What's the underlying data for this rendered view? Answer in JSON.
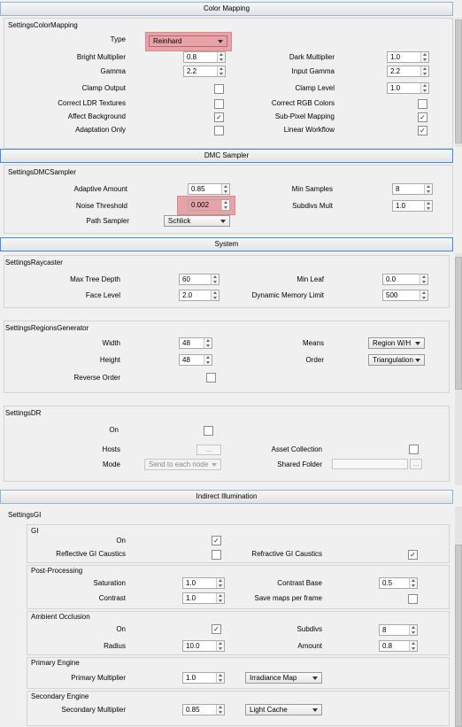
{
  "color_mapping": {
    "header": "Color Mapping",
    "group": "SettingsColorMapping",
    "type_label": "Type",
    "type_value": "Reinhard",
    "bright_label": "Bright Multiplier",
    "bright_value": "0.8",
    "dark_label": "Dark Multiplier",
    "dark_value": "1.0",
    "gamma_label": "Gamma",
    "gamma_value": "2.2",
    "input_gamma_label": "Input Gamma",
    "input_gamma_value": "2.2",
    "clamp_output_label": "Clamp Output",
    "clamp_output_checked": false,
    "clamp_level_label": "Clamp Level",
    "clamp_level_value": "1.0",
    "correct_ldr_label": "Correct LDR Textures",
    "correct_ldr_checked": false,
    "correct_rgb_label": "Correct RGB Colors",
    "correct_rgb_checked": false,
    "affect_bg_label": "Affect Background",
    "affect_bg_checked": true,
    "subpixel_label": "Sub-Pixel Mapping",
    "subpixel_checked": true,
    "adaptation_label": "Adaptation Only",
    "adaptation_checked": false,
    "linear_label": "Linear Workflow",
    "linear_checked": true
  },
  "dmc": {
    "header": "DMC Sampler",
    "group": "SettingsDMCSampler",
    "adaptive_label": "Adaptive Amount",
    "adaptive_value": "0.85",
    "min_samples_label": "Min Samples",
    "min_samples_value": "8",
    "noise_label": "Noise Threshold",
    "noise_value": "0.002",
    "subdivs_mult_label": "Subdivs Mult",
    "subdivs_mult_value": "1.0",
    "path_label": "Path Sampler",
    "path_value": "Schlick"
  },
  "system": {
    "header": "System",
    "raycaster_group": "SettingsRaycaster",
    "max_tree_label": "Max Tree Depth",
    "max_tree_value": "60",
    "min_leaf_label": "Min Leaf",
    "min_leaf_value": "0.0",
    "face_level_label": "Face Level",
    "face_level_value": "2.0",
    "dyn_mem_label": "Dynamic Memory Limit",
    "dyn_mem_value": "500",
    "regions_group": "SettingsRegionsGenerator",
    "width_label": "Width",
    "width_value": "48",
    "means_label": "Means",
    "means_value": "Region W/H",
    "height_label": "Height",
    "height_value": "48",
    "order_label": "Order",
    "order_value": "Triangulation",
    "reverse_label": "Reverse Order",
    "reverse_checked": false,
    "dr_group": "SettingsDR",
    "on_label": "On",
    "on_checked": false,
    "hosts_label": "Hosts",
    "hosts_button": "...",
    "asset_label": "Asset Collection",
    "asset_checked": false,
    "mode_label": "Mode",
    "mode_value": "Send to each node",
    "shared_label": "Shared Folder",
    "shared_value": "",
    "shared_button": "..."
  },
  "gi": {
    "header": "Indirect Illumination",
    "group": "SettingsGI",
    "gi_sub": "GI",
    "on_label": "On",
    "on_checked": true,
    "reflective_label": "Reflective GI Caustics",
    "reflective_checked": false,
    "refractive_label": "Refractive GI Caustics",
    "refractive_checked": true,
    "post_sub": "Post-Processing",
    "saturation_label": "Saturation",
    "saturation_value": "1.0",
    "contrast_base_label": "Contrast Base",
    "contrast_base_value": "0.5",
    "contrast_label": "Contrast",
    "contrast_value": "1.0",
    "save_maps_label": "Save maps per frame",
    "save_maps_checked": false,
    "ao_sub": "Ambient Occlusion",
    "ao_on_label": "On",
    "ao_on_checked": true,
    "subdivs_label": "Subdivs",
    "subdivs_value": "8",
    "radius_label": "Radius",
    "radius_value": "10.0",
    "amount_label": "Amount",
    "amount_value": "0.8",
    "primary_sub": "Primary Engine",
    "primary_mult_label": "Primary Multiplier",
    "primary_mult_value": "1.0",
    "primary_engine_value": "Irradiance Map",
    "secondary_sub": "Secondary Engine",
    "secondary_mult_label": "Secondary Multiplier",
    "secondary_mult_value": "0.85",
    "secondary_engine_value": "Light Cache"
  },
  "checkmark": "✓"
}
